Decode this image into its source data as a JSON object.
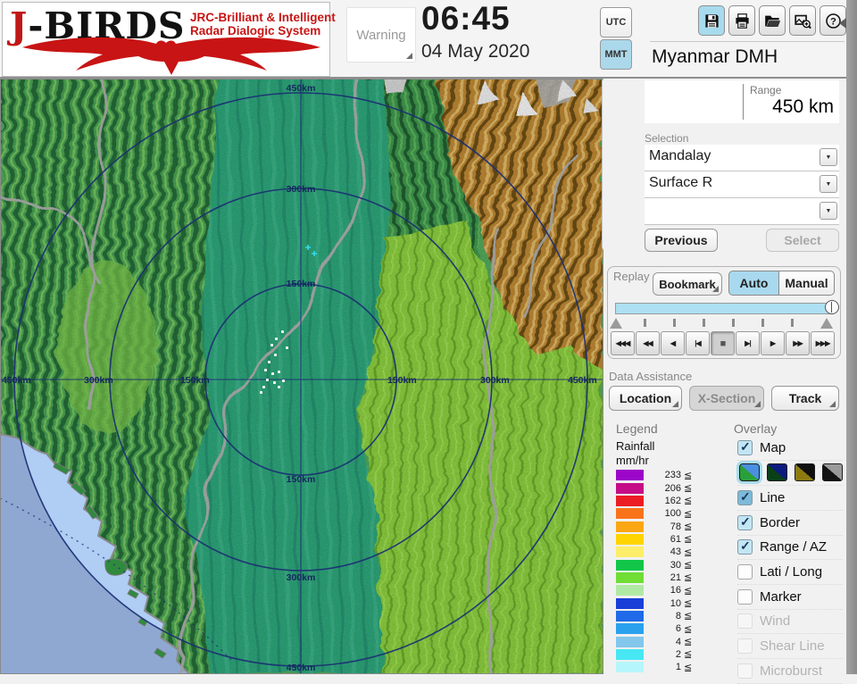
{
  "header": {
    "logo": {
      "brand_first": "J",
      "brand_rest": "-BIRDS",
      "tagline1": "JRC-Brilliant & Intelligent",
      "tagline2": "Radar  Dialogic  System"
    },
    "warning_button": "Warning",
    "clock": {
      "time": "06:45",
      "date": "04 May 2020"
    },
    "timezone": {
      "utc": "UTC",
      "mmt": "MMT",
      "selected": "MMT"
    },
    "toolbar": [
      {
        "name": "save-icon",
        "active": true
      },
      {
        "name": "print-icon",
        "active": false
      },
      {
        "name": "open-folder-icon",
        "active": false
      },
      {
        "name": "capture-add-icon",
        "active": false
      },
      {
        "name": "help-icon",
        "active": false
      }
    ],
    "station_name": "Myanmar DMH"
  },
  "range_panel": {
    "label": "Range",
    "value": "450 km"
  },
  "selection": {
    "label": "Selection",
    "dropdowns": [
      {
        "value": "Mandalay"
      },
      {
        "value": "Surface R"
      },
      {
        "value": ""
      }
    ],
    "previous": "Previous",
    "select": "Select"
  },
  "replay": {
    "label": "Replay",
    "bookmark": "Bookmark",
    "auto": "Auto",
    "manual": "Manual",
    "mode_selected": "Auto",
    "slider_percent": 100,
    "playback": [
      {
        "name": "fast-rewind-button",
        "glyph": "◀◀◀",
        "pressed": false
      },
      {
        "name": "rewind-button",
        "glyph": "◀◀",
        "pressed": false
      },
      {
        "name": "play-reverse-button",
        "glyph": "◀",
        "pressed": false
      },
      {
        "name": "step-back-button",
        "glyph": "|◀",
        "pressed": false
      },
      {
        "name": "stop-button",
        "glyph": "■",
        "pressed": true
      },
      {
        "name": "step-forward-button",
        "glyph": "▶|",
        "pressed": false
      },
      {
        "name": "play-button",
        "glyph": "▶",
        "pressed": false
      },
      {
        "name": "fast-forward-button",
        "glyph": "▶▶",
        "pressed": false
      },
      {
        "name": "fastest-forward-button",
        "glyph": "▶▶▶",
        "pressed": false
      }
    ]
  },
  "data_assistance": {
    "label": "Data Assistance",
    "buttons": [
      {
        "label": "Location",
        "enabled": true
      },
      {
        "label": "X-Section",
        "enabled": false
      },
      {
        "label": "Track",
        "enabled": true
      }
    ]
  },
  "legend": {
    "label": "Legend",
    "unit_line1": "Rainfall",
    "unit_line2": "mm/hr",
    "comparator": "≦",
    "entries": [
      {
        "value": "233",
        "color": "#9c06c9"
      },
      {
        "value": "206",
        "color": "#c40d86"
      },
      {
        "value": "162",
        "color": "#ec1c24"
      },
      {
        "value": "100",
        "color": "#f9731b"
      },
      {
        "value": "78",
        "color": "#fba713"
      },
      {
        "value": "61",
        "color": "#ffd400"
      },
      {
        "value": "43",
        "color": "#fdee6a"
      },
      {
        "value": "30",
        "color": "#12c64a"
      },
      {
        "value": "21",
        "color": "#71dd35"
      },
      {
        "value": "16",
        "color": "#b0e9a4"
      },
      {
        "value": "10",
        "color": "#1a3fd8"
      },
      {
        "value": "8",
        "color": "#1f6ae8"
      },
      {
        "value": "6",
        "color": "#2ba1ee"
      },
      {
        "value": "4",
        "color": "#83c7ec"
      },
      {
        "value": "2",
        "color": "#47e7f3"
      },
      {
        "value": "1",
        "color": "#b5f6fb"
      }
    ]
  },
  "overlay": {
    "label": "Overlay",
    "check_glyph": "✓",
    "items": [
      {
        "label": "Map",
        "checked": true,
        "enabled": true,
        "dark": false
      },
      {
        "label": "Line",
        "checked": true,
        "enabled": true,
        "dark": true
      },
      {
        "label": "Border",
        "checked": true,
        "enabled": true,
        "dark": false
      },
      {
        "label": "Range / AZ",
        "checked": true,
        "enabled": true,
        "dark": false
      },
      {
        "label": "Lati / Long",
        "checked": false,
        "enabled": true,
        "dark": false
      },
      {
        "label": "Marker",
        "checked": false,
        "enabled": true,
        "dark": false
      },
      {
        "label": "Wind",
        "checked": false,
        "enabled": false,
        "dark": false
      },
      {
        "label": "Shear Line",
        "checked": false,
        "enabled": false,
        "dark": false
      },
      {
        "label": "Microburst",
        "checked": false,
        "enabled": false,
        "dark": false
      }
    ],
    "map_styles": [
      {
        "name": "map-style-terrain",
        "selected": true,
        "c1": "#4a8fe0",
        "c2": "#2aa03a"
      },
      {
        "name": "map-style-dark",
        "selected": false,
        "c1": "#0c1a80",
        "c2": "#0a3f18"
      },
      {
        "name": "map-style-olive",
        "selected": false,
        "c1": "#101010",
        "c2": "#8d7b12"
      },
      {
        "name": "map-style-gray",
        "selected": false,
        "c1": "#9a9a9a",
        "c2": "#141414"
      }
    ]
  },
  "map": {
    "ring_labels": [
      "150km",
      "300km",
      "450km"
    ],
    "ring_color": "#1b2f73"
  },
  "ui": {
    "dropdown_arrow": "▼"
  }
}
